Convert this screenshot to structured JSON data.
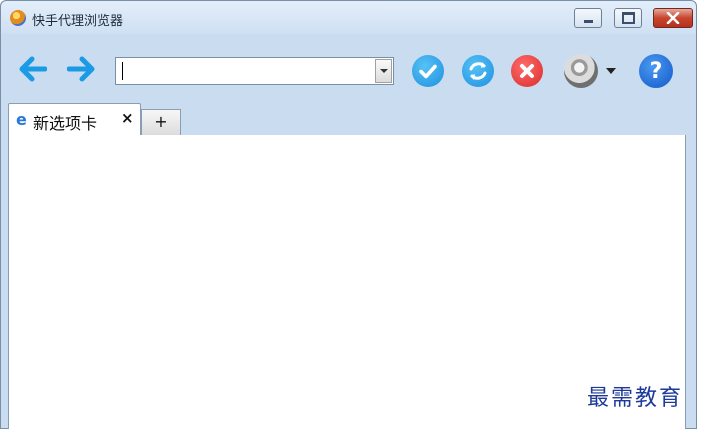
{
  "window": {
    "title": "快手代理浏览器"
  },
  "address_bar": {
    "value": "",
    "placeholder": ""
  },
  "tabs": [
    {
      "label": "新选项卡",
      "close": "×"
    }
  ],
  "new_tab_label": "+",
  "help_label": "?",
  "watermark": "最需教育",
  "colors": {
    "accent_blue": "#1e8fe0",
    "stop_red": "#d92c2c",
    "frame": "#c9dcf0"
  }
}
